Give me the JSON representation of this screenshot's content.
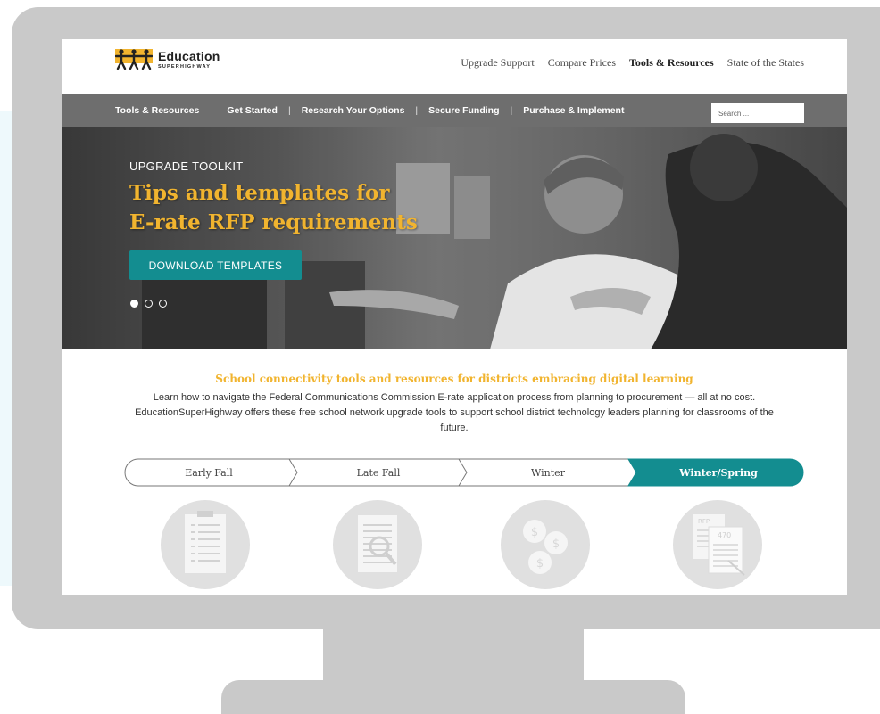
{
  "header": {
    "logo_name": "Education",
    "logo_sub": "SUPERHIGHWAY",
    "nav": [
      "Upgrade Support",
      "Compare Prices",
      "Tools & Resources",
      "State of the States"
    ]
  },
  "subnav": {
    "first": "Tools & Resources",
    "items": [
      "Get Started",
      "Research Your Options",
      "Secure Funding",
      "Purchase & Implement"
    ],
    "search_placeholder": "Search ..."
  },
  "hero": {
    "kicker": "UPGRADE TOOLKIT",
    "title_line1": "Tips and templates for",
    "title_line2": "E-rate RFP requirements",
    "button": "DOWNLOAD TEMPLATES",
    "slides_total": 3,
    "slide_active": 1
  },
  "intro": {
    "title": "School connectivity tools and resources for districts embracing digital learning",
    "body": "Learn how to navigate the Federal Communications Commission E-rate application process from planning to procurement — all at no cost. EducationSuperHighway offers these free school network upgrade tools to support school district technology leaders planning for classrooms of the future."
  },
  "timeline": {
    "stages": [
      "Early Fall",
      "Late Fall",
      "Winter",
      "Winter/Spring"
    ],
    "active_index": 3
  },
  "icons": {
    "items": [
      "checklist-icon",
      "document-search-icon",
      "coins-icon",
      "rfp-document-icon"
    ],
    "rfp_label": "RFP",
    "form_number": "470"
  },
  "colors": {
    "accent_teal": "#138d90",
    "accent_gold": "#f1b42f",
    "nav_gray": "#6e6e6e",
    "monitor_gray": "#c9c9c9"
  }
}
